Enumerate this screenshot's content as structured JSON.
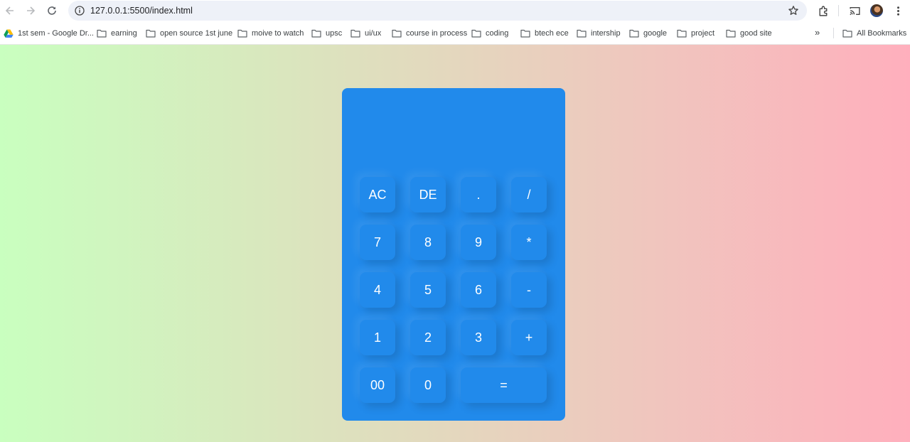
{
  "browser": {
    "url": "127.0.0.1:5500/index.html",
    "bookmarks": [
      {
        "label": "1st sem - Google Dr...",
        "icon": "google-drive-icon"
      },
      {
        "label": "earning",
        "icon": "folder-icon"
      },
      {
        "label": "open source 1st june",
        "icon": "folder-icon"
      },
      {
        "label": "moive to watch",
        "icon": "folder-icon"
      },
      {
        "label": "upsc",
        "icon": "folder-icon"
      },
      {
        "label": "ui/ux",
        "icon": "folder-icon"
      },
      {
        "label": "course in process",
        "icon": "folder-icon"
      },
      {
        "label": "coding",
        "icon": "folder-icon"
      },
      {
        "label": "btech ece",
        "icon": "folder-icon"
      },
      {
        "label": "intership",
        "icon": "folder-icon"
      },
      {
        "label": "google",
        "icon": "folder-icon"
      },
      {
        "label": "project",
        "icon": "folder-icon"
      },
      {
        "label": "good site",
        "icon": "folder-icon"
      }
    ],
    "more_label": "»",
    "all_bookmarks": "All Bookmarks"
  },
  "calculator": {
    "display_value": "",
    "keys": [
      "AC",
      "DE",
      ".",
      "/",
      "7",
      "8",
      "9",
      "*",
      "4",
      "5",
      "6",
      "-",
      "1",
      "2",
      "3",
      "+",
      "00",
      "0",
      "="
    ]
  },
  "colors": {
    "calculator_bg": "#218aeb",
    "gradient_start": "#c9ffbf",
    "gradient_end": "#ffafbd"
  }
}
